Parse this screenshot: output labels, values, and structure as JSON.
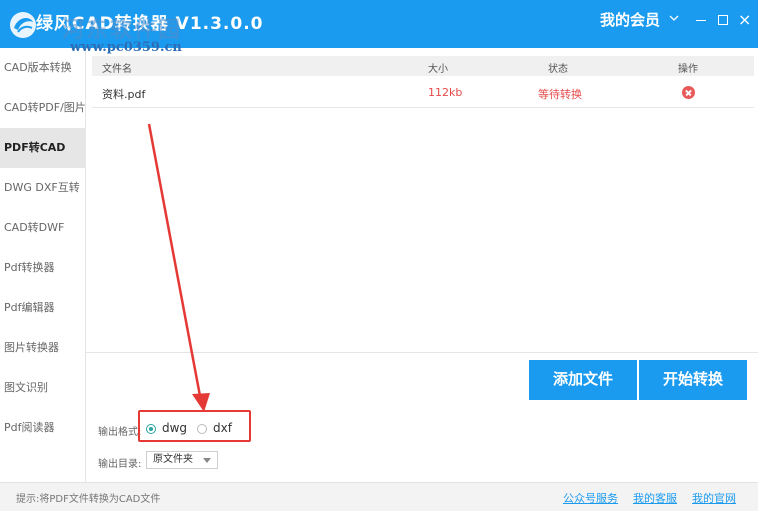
{
  "titlebar": {
    "app_title": "绿风CAD转换器 V1.3.0.0",
    "watermark_text": "河东软件园",
    "watermark_url": "www.pc0359.cn",
    "member_label": "我的会员",
    "close_glyph": "×"
  },
  "sidebar": {
    "items": [
      {
        "label": "CAD版本转换"
      },
      {
        "label": "CAD转PDF/图片"
      },
      {
        "label": "PDF转CAD"
      },
      {
        "label": "DWG DXF互转"
      },
      {
        "label": "CAD转DWF"
      },
      {
        "label": "Pdf转换器"
      },
      {
        "label": "Pdf编辑器"
      },
      {
        "label": "图片转换器"
      },
      {
        "label": "图文识别"
      },
      {
        "label": "Pdf阅读器"
      }
    ],
    "active_index": 2
  },
  "table": {
    "headers": {
      "name": "文件名",
      "size": "大小",
      "status": "状态",
      "action": "操作"
    },
    "rows": [
      {
        "name": "资料.pdf",
        "size": "112kb",
        "status": "等待转换"
      }
    ]
  },
  "buttons": {
    "add_file": "添加文件",
    "start_convert": "开始转换"
  },
  "options": {
    "output_format_label": "输出格式:",
    "formats": [
      {
        "label": "dwg",
        "checked": true
      },
      {
        "label": "dxf",
        "checked": false
      }
    ],
    "output_dir_label": "输出目录:",
    "output_dir_value": "原文件夹"
  },
  "statusbar": {
    "hint": "提示:将PDF文件转换为CAD文件",
    "links": [
      "公众号服务",
      "我的客服",
      "我的官网"
    ]
  },
  "colors": {
    "accent": "#1b9bef",
    "highlight": "#e53935",
    "status_red": "#e64a4a"
  }
}
